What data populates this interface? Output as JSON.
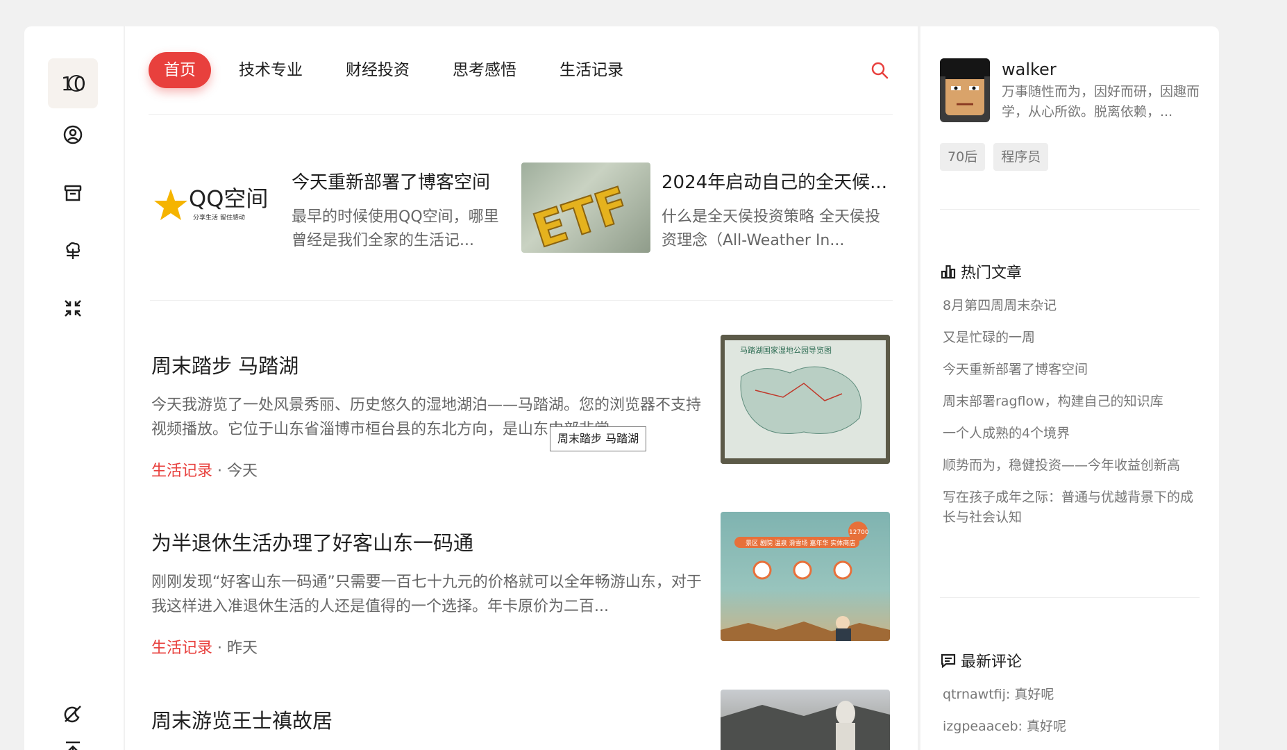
{
  "sidebar": {
    "logo_text": "10",
    "icons": [
      "user-circle-icon",
      "archive-icon",
      "tree-icon",
      "shrink-icon",
      "moon-off-icon",
      "back-to-top-icon"
    ]
  },
  "nav": {
    "items": [
      "首页",
      "技术专业",
      "财经投资",
      "思考感悟",
      "生活记录"
    ],
    "active_index": 0,
    "accent_color": "#e8403d"
  },
  "featured": [
    {
      "title": "今天重新部署了博客空间",
      "desc": "最早的时候使用QQ空间，哪里曾经是我们全家的生活记...",
      "image_text": "QQ空间",
      "image_subtext": "分享生活   留住感动"
    },
    {
      "title": "2024年启动自己的全天候...",
      "desc": "什么是全天侯投资策略 全天侯投资理念（All-Weather In...",
      "image_text": "ETF"
    }
  ],
  "posts": [
    {
      "title": "周末踏步 马踏湖",
      "desc": "今天我游览了一处风景秀丽、历史悠久的湿地湖泊——马踏湖。您的浏览器不支持视频播放。它位于山东省淄博市桓台县的东北方向，是山东中部非常...",
      "category": "生活记录",
      "time": "今天",
      "thumb_text": "马踏湖国家湿地公园导览图"
    },
    {
      "title": "为半退休生活办理了好客山东一码通",
      "desc": "刚刚发现“好客山东一码通”只需要一百七十九元的价格就可以全年畅游山东，对于我这样进入准退休生活的人还是值得的一个选择。年卡原价为二百...",
      "category": "生活记录",
      "time": "昨天",
      "thumb_text": "景区 剧院 温泉 滑雪场 嘉年华 实体商店",
      "thumb_badge": "12700"
    },
    {
      "title": "周末游览王士禛故居",
      "desc": "",
      "category": "",
      "time": ""
    }
  ],
  "tooltip": "周末踏步 马踏湖",
  "meta_separator": " · ",
  "profile": {
    "name": "walker",
    "bio": "万事随性而为，因好而研，因趣而学，从心所欲。脱离依赖，...",
    "tags": [
      "70后",
      "程序员"
    ]
  },
  "hot": {
    "title": "热门文章",
    "items": [
      "8月第四周周末杂记",
      "又是忙碌的一周",
      "今天重新部署了博客空间",
      "周末部署ragflow，构建自己的知识库",
      "一个人成熟的4个境界",
      "顺势而为，稳健投资——今年收益创新高",
      "写在孩子成年之际：普通与优越背景下的成长与社会认知"
    ]
  },
  "comments": {
    "title": "最新评论",
    "items": [
      "qtrnawtfij: 真好呢",
      "izgpeaaceb: 真好呢"
    ]
  }
}
